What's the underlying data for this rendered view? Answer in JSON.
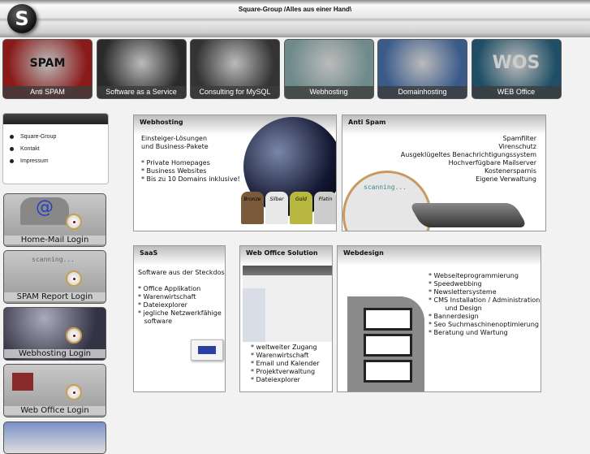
{
  "header": {
    "title": "Square-Group /Alles aus einer Hand\\",
    "logo_letter": "S"
  },
  "nav": [
    {
      "label": "Anti SPAM",
      "art": "SPAM",
      "color": "#8a1a1a"
    },
    {
      "label": "Software as a Service",
      "art": "",
      "color": "#2a2a2a"
    },
    {
      "label": "Consulting for MySQL",
      "art": "",
      "color": "#333"
    },
    {
      "label": "Webhosting",
      "art": "",
      "color": "#6f8a8a"
    },
    {
      "label": "Domainhosting",
      "art": "",
      "color": "#3a5a8a"
    },
    {
      "label": "WEB Office",
      "art": "WOS",
      "color": "#1f4f66"
    }
  ],
  "menu": {
    "items": [
      "Square-Group",
      "Kontakt",
      "Impressum"
    ]
  },
  "logins": [
    "Home-Mail Login",
    "SPAM Report Login",
    "Webhosting Login",
    "Web Office Login"
  ],
  "panels": {
    "webhosting": {
      "title": "Webhosting",
      "lines": [
        "Einsteiger-Lösungen",
        "und Business-Pakete",
        "",
        "* Private Homepages",
        "* Business Websites",
        "* Bis zu 10 Domains inklusive!"
      ],
      "badges": [
        "Bronze",
        "Silber",
        "Gold",
        "Platin"
      ]
    },
    "antispam": {
      "title": "Anti Spam",
      "lines": [
        "Spamfilter",
        "Virenschutz",
        "Ausgeklügeltes Benachrichtigungssystem",
        "Hochverfügbare Mailserver",
        "Kostenersparnis",
        "Eigene Verwaltung"
      ],
      "scan": "scanning..."
    },
    "saas": {
      "title": "SaaS",
      "lines": [
        "Software aus der Steckdose",
        "",
        "* Office Applikation",
        "* Warenwirtschaft",
        "* Dateiexplorer",
        "* jegliche Netzwerkfähige",
        "   software"
      ]
    },
    "weboffice": {
      "title": "Web Office Solution",
      "lines": [
        "* weltweiter Zugang",
        "* Warenwirtschaft",
        "* Email und Kalender",
        "* Projektverwaltung",
        "* Dateiexplorer"
      ]
    },
    "webdesign": {
      "title": "Webdesign",
      "lines": [
        "* Webseiteprogrammierung",
        "* Speedwebbing",
        "* Newslettersysteme",
        "* CMS Installation / Administration",
        "        und Design",
        "* Bannerdesign",
        "* Seo Suchmaschinenoptimierung",
        "* Beratung und Wartung"
      ]
    }
  }
}
